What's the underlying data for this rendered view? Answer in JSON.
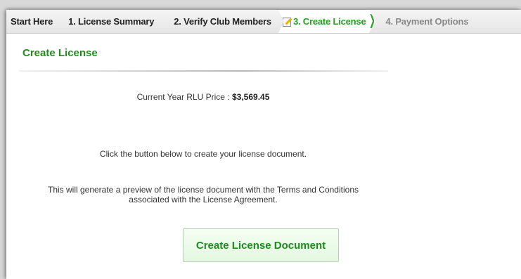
{
  "tabs": [
    {
      "label": "Start Here"
    },
    {
      "label": "1. License Summary"
    },
    {
      "label": "2. Verify Club Members"
    },
    {
      "label": "3. Create License"
    },
    {
      "label": "4. Payment Options"
    }
  ],
  "main": {
    "title": "Create License",
    "price_label": "Current Year RLU Price : ",
    "price_value": "$3,569.45",
    "instruction": "Click the button below to create your license document.",
    "preview_line1": "This will generate a preview of the license document with the Terms and Conditions",
    "preview_line2": "associated with the License Agreement.",
    "button_label": "Create License Document"
  },
  "colors": {
    "accent_green": "#1d8f1d",
    "button_bg": "#e3f7e0"
  },
  "icons": {
    "active_tab_icon": "edit-document-icon",
    "active_tab_arrow": "chevron-right-icon"
  }
}
